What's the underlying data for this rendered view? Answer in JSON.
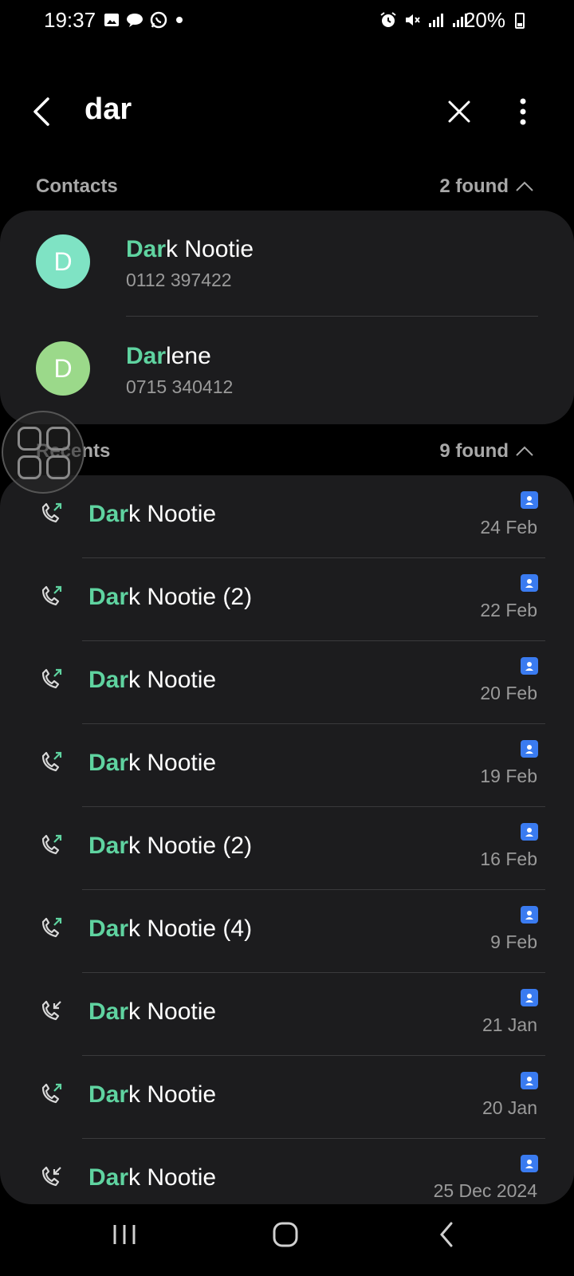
{
  "status_bar": {
    "time": "19:37",
    "battery": "20%"
  },
  "search": {
    "query": "dar"
  },
  "highlight_color": "#5fd3a0",
  "contacts_section": {
    "title": "Contacts",
    "count": "2 found",
    "items": [
      {
        "initial": "D",
        "name_match": "Dar",
        "name_rest": "k Nootie",
        "number": "0112 397422",
        "avatar_color": "#7fe3c4"
      },
      {
        "initial": "D",
        "name_match": "Dar",
        "name_rest": "lene",
        "number": "0715 340412",
        "avatar_color": "#9bd98a"
      }
    ]
  },
  "recents_section": {
    "title": "Recents",
    "count": "9 found",
    "items": [
      {
        "direction": "outgoing",
        "name_match": "Dar",
        "name_rest": "k Nootie",
        "date": "24 Feb"
      },
      {
        "direction": "outgoing",
        "name_match": "Dar",
        "name_rest": "k Nootie (2)",
        "date": "22 Feb"
      },
      {
        "direction": "outgoing",
        "name_match": "Dar",
        "name_rest": "k Nootie",
        "date": "20 Feb"
      },
      {
        "direction": "outgoing",
        "name_match": "Dar",
        "name_rest": "k Nootie",
        "date": "19 Feb"
      },
      {
        "direction": "outgoing",
        "name_match": "Dar",
        "name_rest": "k Nootie (2)",
        "date": "16 Feb"
      },
      {
        "direction": "outgoing",
        "name_match": "Dar",
        "name_rest": "k Nootie (4)",
        "date": "9 Feb"
      },
      {
        "direction": "incoming",
        "name_match": "Dar",
        "name_rest": "k Nootie",
        "date": "21 Jan"
      },
      {
        "direction": "outgoing",
        "name_match": "Dar",
        "name_rest": "k Nootie",
        "date": "20 Jan"
      },
      {
        "direction": "incoming",
        "name_match": "Dar",
        "name_rest": "k Nootie",
        "date": "25 Dec 2024"
      }
    ]
  }
}
